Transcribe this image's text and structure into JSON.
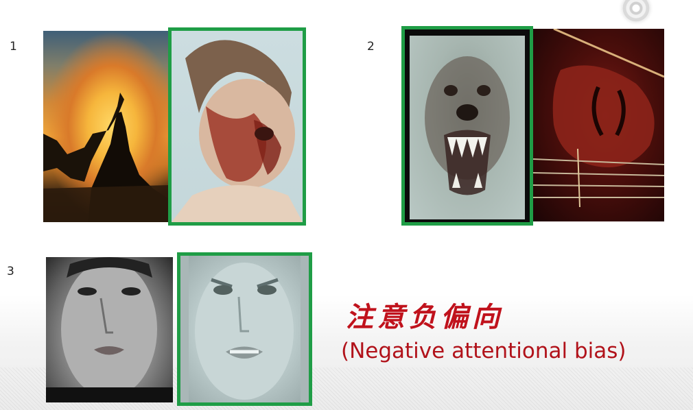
{
  "slide": {
    "labels": [
      "1",
      "2",
      "3"
    ],
    "title_cn": "注意负偏向",
    "title_en": "(Negative attentional bias)"
  },
  "colors": {
    "highlight_frame": "#1f9d46",
    "title": "#c0121c"
  },
  "icons": {
    "corner": "camera-record-icon"
  },
  "images": {
    "pair1": [
      "sunset-silhouette-image",
      "injured-face-image"
    ],
    "pair2": [
      "snarling-dog-image",
      "violin-image"
    ],
    "pair3": [
      "neutral-face-image",
      "angry-face-image"
    ]
  }
}
